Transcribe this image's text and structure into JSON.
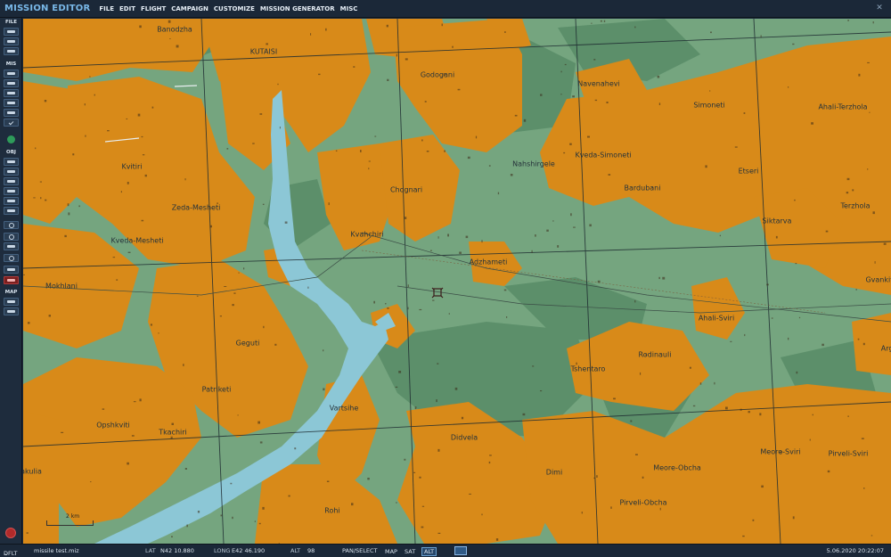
{
  "app": {
    "title": "MISSION EDITOR",
    "close_icon": "close-icon"
  },
  "menu": [
    "FILE",
    "EDIT",
    "FLIGHT",
    "CAMPAIGN",
    "CUSTOMIZE",
    "MISSION GENERATOR",
    "MISC"
  ],
  "sidebar": {
    "sections": [
      "FILE",
      "MIS",
      "OBJ",
      "MAP"
    ]
  },
  "map": {
    "colors": {
      "ground": "#75a57f",
      "urban": "#d88a19",
      "forest": "#5c8f6a",
      "water": "#8cc7d6"
    },
    "scale_label": "2 km",
    "towns": [
      "Banodzha",
      "KUTAISI",
      "Godogani",
      "Navenahevi",
      "Simoneti",
      "Ahali-Terzhola",
      "Kvitiri",
      "Nahshirgele",
      "Kveda-Simoneti",
      "Etseri",
      "Chognari",
      "Bardubani",
      "Zeda-Mesheti",
      "Terzhola",
      "Siktarva",
      "Kveda-Mesheti",
      "Kvahchiri",
      "Adzhameti",
      "Gvankiti",
      "Mokhlani",
      "Ahali-Sviri",
      "Geguti",
      "Rodinauli",
      "Argv",
      "Tshentaro",
      "Patriketi",
      "Vartsihe",
      "Opshkviti",
      "Tkachiri",
      "Didvela",
      "Meore-Obcha",
      "Meore-Sviri",
      "Pirveli-Sviri",
      "Dimi",
      "akulia",
      "Pirveli-Obcha",
      "Rohi"
    ]
  },
  "status": {
    "profile": "DFLT",
    "file": "missile test.miz",
    "lat_label": "LAT",
    "lat": "N42 10.880",
    "long_label": "LONG",
    "long": "E42 46.190",
    "alt_label": "ALT",
    "alt": "98",
    "mode": "PAN/SELECT",
    "map_btn": "MAP",
    "sat_btn": "SAT",
    "alt_btn": "ALT",
    "datetime": "5.06.2020 20:22:07"
  }
}
